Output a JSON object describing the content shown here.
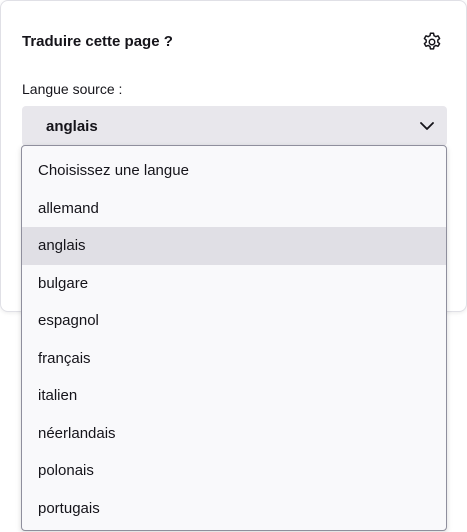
{
  "panel": {
    "title": "Traduire cette page ?",
    "settings_icon": "gear-icon"
  },
  "source": {
    "label": "Langue source :",
    "selected_value": "anglais",
    "chevron_icon": "chevron-down-icon"
  },
  "dropdown": {
    "options": [
      {
        "label": "Choisissez une langue"
      },
      {
        "label": "allemand"
      },
      {
        "label": "anglais",
        "selected": true
      },
      {
        "label": "bulgare"
      },
      {
        "label": "espagnol"
      },
      {
        "label": "français"
      },
      {
        "label": "italien"
      },
      {
        "label": "néerlandais"
      },
      {
        "label": "polonais"
      },
      {
        "label": "portugais"
      }
    ]
  },
  "colors": {
    "select_bg": "#e8e7ec",
    "selected_option_bg": "#e0dfe5",
    "dropdown_bg": "#f9f9fb",
    "text": "#15141a"
  }
}
